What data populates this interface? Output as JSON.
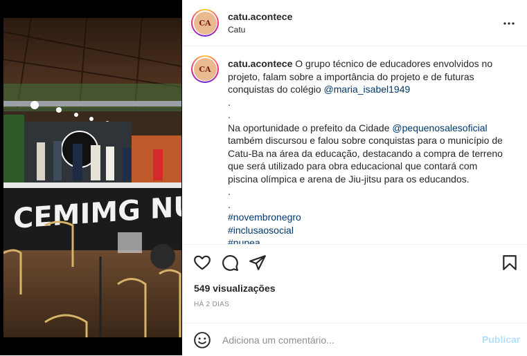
{
  "post": {
    "username": "catu.acontece",
    "location": "Catu",
    "avatar_text": "CA",
    "media_banner_text": "CEMIMG NUPE",
    "caption": {
      "username": "catu.acontece",
      "line1_text": " O grupo técnico de educadores envolvidos no projeto, falam sobre a importância do projeto e de futuras conquistas do colégio ",
      "line1_mention": "@maria_isabel1949",
      "dot": ".",
      "para2_text1": "Na oportunidade o prefeito da Cidade ",
      "para2_mention": "@pequenosalesoficial",
      "para2_text2": " também discursou e falou sobre conquistas para o município de Catu-Ba na área da educação, destacando a compra de terreno que será utilizado para obra educacional que contará com piscina olímpica e arena de Jiu-jitsu para os educandos.",
      "hashtags": [
        "#novembronegro",
        "#inclusaosocial",
        "#nupea"
      ]
    },
    "views": "549 visualizações",
    "date": "HÁ 2 DIAS",
    "comment_placeholder": "Adiciona um comentário...",
    "publish_label": "Publicar"
  },
  "icons": {
    "more": "more-options-icon",
    "like": "heart-icon",
    "comment": "comment-icon",
    "share": "share-icon",
    "save": "bookmark-icon",
    "emoji": "emoji-icon"
  },
  "colors": {
    "link": "#00376b",
    "muted": "#8e8e8e",
    "publish_disabled": "#b2dffc"
  }
}
